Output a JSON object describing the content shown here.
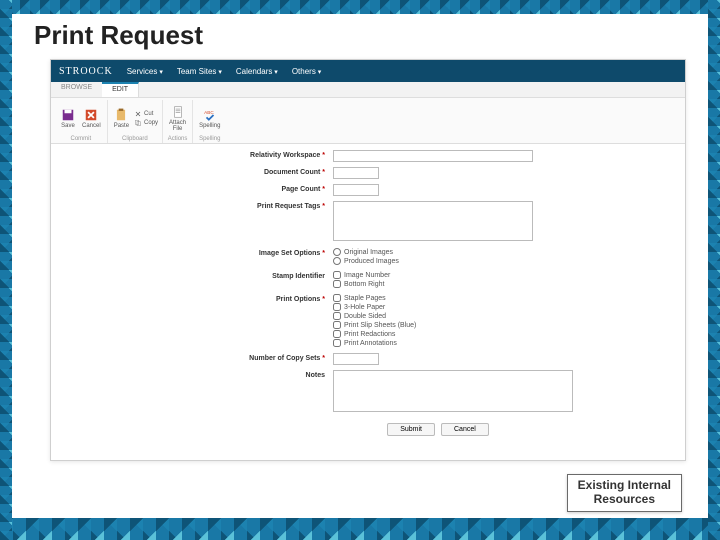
{
  "slide": {
    "title": "Print Request",
    "caption_line1": "Existing Internal",
    "caption_line2": "Resources"
  },
  "topnav": {
    "brand": "STROOCK",
    "items": [
      "Services",
      "Team Sites",
      "Calendars",
      "Others"
    ]
  },
  "tabs": {
    "browse": "BROWSE",
    "edit": "EDIT"
  },
  "ribbon": {
    "commit": {
      "save": "Save",
      "cancel": "Cancel",
      "caption": "Commit"
    },
    "clipboard": {
      "paste": "Paste",
      "cut": "Cut",
      "copy": "Copy",
      "caption": "Clipboard"
    },
    "actions": {
      "attach": "Attach\nFile",
      "caption": "Actions"
    },
    "spelling": {
      "spelling": "Spelling",
      "caption": "Spelling"
    }
  },
  "form": {
    "relativity_workspace": {
      "label": "Relativity Workspace",
      "value": ""
    },
    "document_count": {
      "label": "Document Count",
      "value": ""
    },
    "page_count": {
      "label": "Page Count",
      "value": ""
    },
    "print_request_tags": {
      "label": "Print Request Tags",
      "value": ""
    },
    "image_set_options": {
      "label": "Image Set Options",
      "options": [
        "Original Images",
        "Produced Images"
      ]
    },
    "stamp_identifier": {
      "label": "Stamp Identifier",
      "options": [
        "Image Number",
        "Bottom Right"
      ]
    },
    "print_options": {
      "label": "Print Options",
      "options": [
        "Staple Pages",
        "3-Hole Paper",
        "Double Sided",
        "Print Slip Sheets (Blue)",
        "Print Redactions",
        "Print Annotations"
      ]
    },
    "number_of_copy_sets": {
      "label": "Number of Copy Sets",
      "value": ""
    },
    "notes": {
      "label": "Notes",
      "value": ""
    }
  },
  "buttons": {
    "submit": "Submit",
    "cancel": "Cancel"
  }
}
